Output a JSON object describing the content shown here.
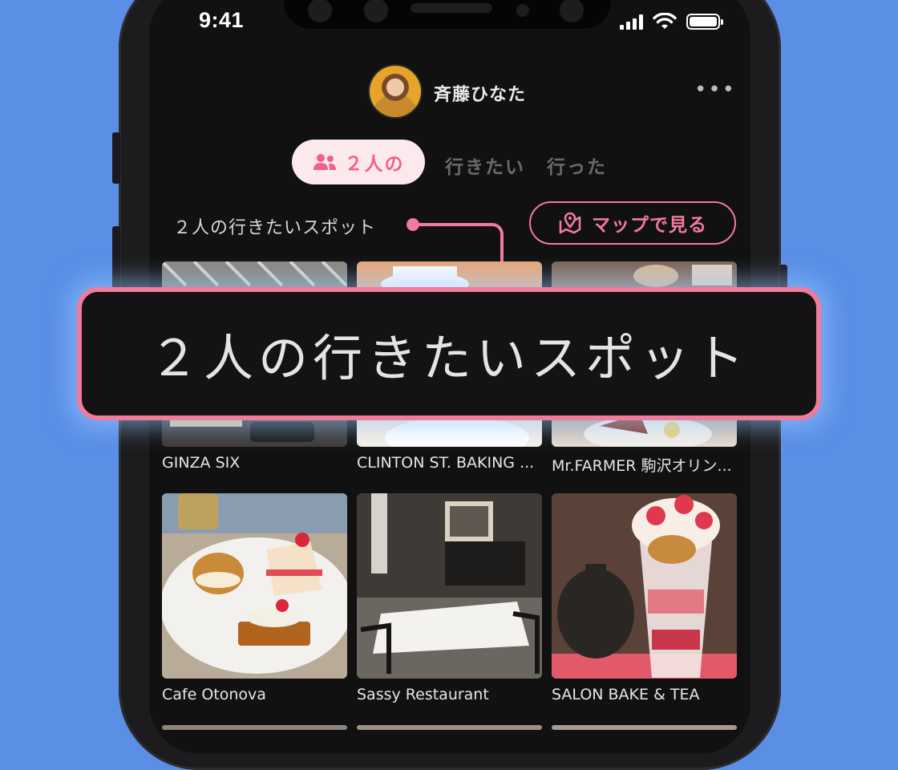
{
  "status_bar": {
    "time": "9:41"
  },
  "header": {
    "username": "斉藤ひなた"
  },
  "tabs": [
    {
      "label": "２人の",
      "active": true
    },
    {
      "label": "行きたい",
      "active": false
    },
    {
      "label": "行った",
      "active": false
    }
  ],
  "section": {
    "title": "２人の行きたいスポット",
    "map_button": "マップで見る"
  },
  "callout": {
    "text": "２人の行きたいスポット"
  },
  "spots": [
    {
      "name": "GINZA SIX"
    },
    {
      "name": "CLINTON ST. BAKING ..."
    },
    {
      "name": "Mr.FARMER 駒沢オリン..."
    },
    {
      "name": "Cafe Otonova"
    },
    {
      "name": "Sassy Restaurant"
    },
    {
      "name": "SALON BAKE & TEA"
    }
  ],
  "colors": {
    "accent": "#f27a9b",
    "background": "#5b8fe6",
    "screen": "#111111"
  }
}
